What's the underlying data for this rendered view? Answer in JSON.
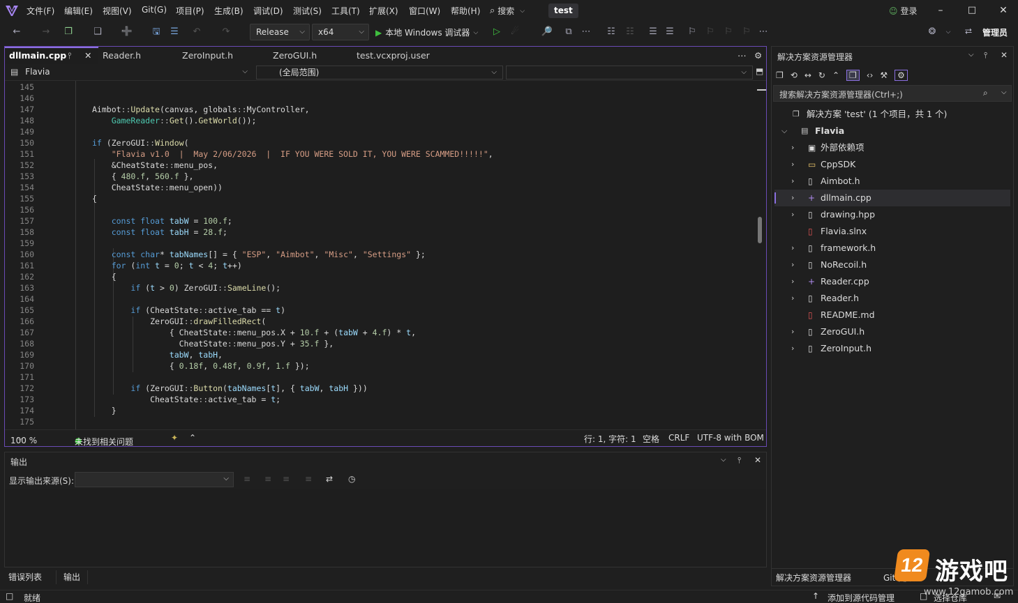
{
  "menu": [
    "文件(F)",
    "编辑(E)",
    "视图(V)",
    "Git(G)",
    "项目(P)",
    "生成(B)",
    "调试(D)",
    "测试(S)",
    "工具(T)",
    "扩展(X)",
    "窗口(W)",
    "帮助(H)"
  ],
  "search_label": "搜索",
  "project_name": "test",
  "login_label": "登录",
  "admin_label": "管理员",
  "toolbar": {
    "config": "Release",
    "platform": "x64",
    "run_label": "本地 Windows 调试器"
  },
  "tabs": [
    "dllmain.cpp",
    "Reader.h",
    "ZeroInput.h",
    "ZeroGUI.h",
    "test.vcxproj.user"
  ],
  "navbar": {
    "project": "Flavia",
    "scope": "(全局范围)"
  },
  "code": {
    "line_numbers": [
      "145",
      "146",
      "147",
      "148",
      "149",
      "150",
      "151",
      "152",
      "153",
      "154",
      "155",
      "156",
      "157",
      "158",
      "159",
      "160",
      "161",
      "162",
      "163",
      "164",
      "165",
      "166",
      "167",
      "168",
      "169",
      "170",
      "171",
      "172",
      "173",
      "174",
      "175"
    ]
  },
  "editor_status": {
    "zoom": "100 %",
    "issues": "未找到相关问题",
    "position": "行: 1, 字符: 1",
    "indent": "空格",
    "eol": "CRLF",
    "encoding": "UTF-8 with BOM"
  },
  "output": {
    "title": "输出",
    "source_label": "显示输出来源(S):"
  },
  "bottom_tabs": [
    "错误列表",
    "输出"
  ],
  "solution_explorer": {
    "title": "解决方案资源管理器",
    "search_placeholder": "搜索解决方案资源管理器(Ctrl+;)",
    "solution_label": "解决方案 'test' (1 个项目，共 1 个)",
    "project": "Flavia",
    "items": [
      {
        "label": "外部依赖项",
        "icon": "external-deps-icon",
        "expandable": true
      },
      {
        "label": "CppSDK",
        "icon": "folder-icon",
        "expandable": true
      },
      {
        "label": "Aimbot.h",
        "icon": "header-file-icon",
        "expandable": true
      },
      {
        "label": "dllmain.cpp",
        "icon": "cpp-file-icon",
        "expandable": true
      },
      {
        "label": "drawing.hpp",
        "icon": "header-file-icon",
        "expandable": true
      },
      {
        "label": "Flavia.slnx",
        "icon": "solution-file-icon",
        "expandable": false
      },
      {
        "label": "framework.h",
        "icon": "header-file-icon",
        "expandable": true
      },
      {
        "label": "NoRecoil.h",
        "icon": "header-file-icon",
        "expandable": true
      },
      {
        "label": "Reader.cpp",
        "icon": "cpp-file-icon",
        "expandable": true
      },
      {
        "label": "Reader.h",
        "icon": "header-file-icon",
        "expandable": true
      },
      {
        "label": "README.md",
        "icon": "markdown-file-icon",
        "expandable": false
      },
      {
        "label": "ZeroGUI.h",
        "icon": "header-file-icon",
        "expandable": true
      },
      {
        "label": "ZeroInput.h",
        "icon": "header-file-icon",
        "expandable": true
      }
    ],
    "bottom_tabs": [
      "解决方案资源管理器",
      "Git 更改"
    ]
  },
  "statusbar": {
    "ready": "就绪",
    "add_source": "添加到源代码管理",
    "select_repo": "选择仓库"
  },
  "watermark": {
    "logo": "12游戏吧",
    "url": "www.12gamob.com"
  },
  "colors": {
    "accent": "#8a6fe0",
    "keyword": "#569cd6",
    "string": "#d69d85",
    "type": "#4ec9b0",
    "function": "#dcdcaa",
    "number": "#b5cea8"
  }
}
